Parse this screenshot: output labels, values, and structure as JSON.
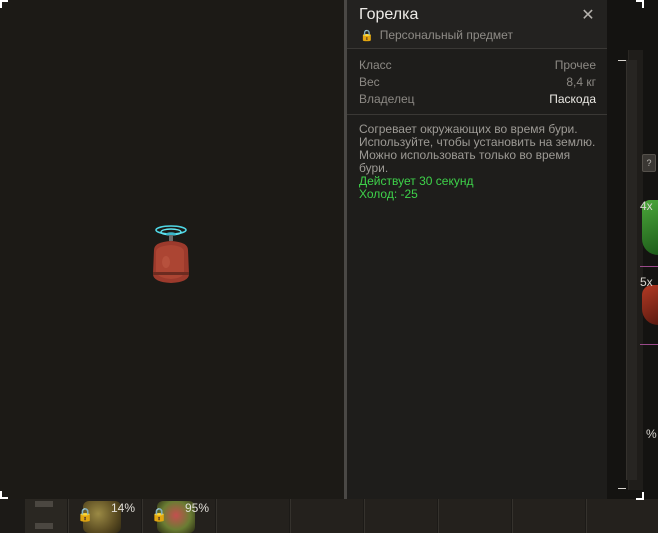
{
  "item": {
    "title": "Горелка",
    "personal_label": "Персональный предмет",
    "props": [
      {
        "key": "Класс",
        "value": "Прочее"
      },
      {
        "key": "Вес",
        "value": "8,4 кг"
      },
      {
        "key": "Владелец",
        "value": "Паскода"
      }
    ],
    "description": "Согревает окружающих во время бури. Используйте, чтобы установить на землю. Можно использовать только во время бури.",
    "stats": [
      "Действует 30 секунд",
      "Холод: -25"
    ]
  },
  "icons": {
    "close": "close-icon",
    "lock": "lock-icon",
    "help": "?"
  },
  "right_edge": {
    "counts": [
      "4x",
      "5x",
      "%"
    ]
  },
  "hotbar": {
    "slots": [
      {
        "percent": "14%"
      },
      {
        "percent": "95%"
      }
    ]
  },
  "colors": {
    "stat_green": "#3ed24a",
    "panel_bg": "#1e1d1b",
    "preview_bg": "#1c1a16"
  }
}
